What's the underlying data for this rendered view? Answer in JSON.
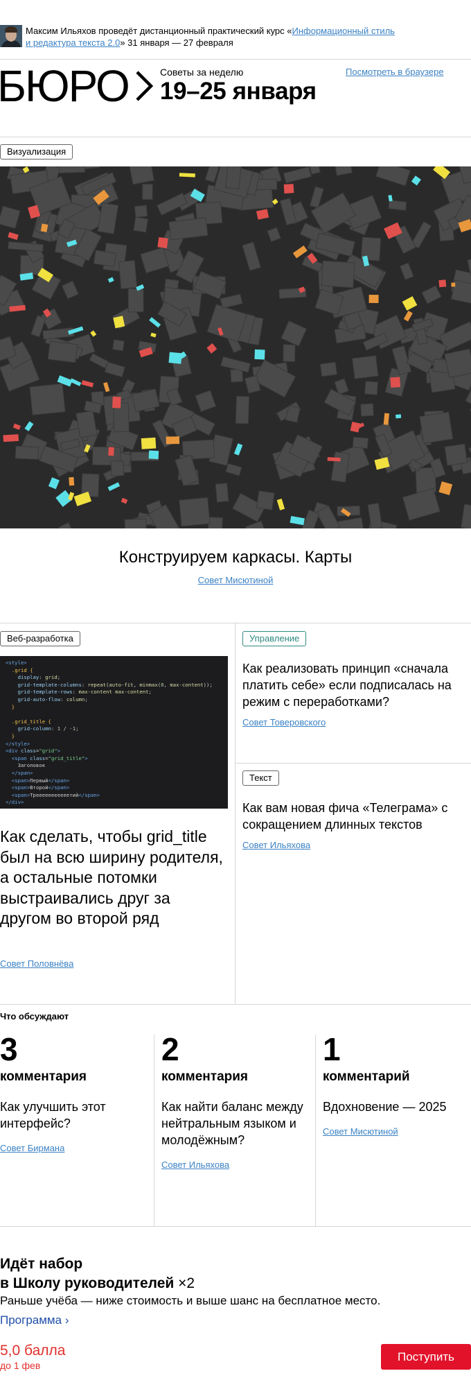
{
  "promo": {
    "text_before": "Максим Ильяхов проведёт дистанционный практический курс «",
    "course_line1": "Информационный стиль",
    "course_line2": "и редактура текста 2.0",
    "text_after": "» 31 января — 27 февраля"
  },
  "header": {
    "logo_text": "БЮРО",
    "kicker": "Советы за неделю",
    "date_range": "19–25 января",
    "browser_link": "Посмотреть в браузере"
  },
  "featured": {
    "tag": "Визуализация",
    "title": "Конструируем каркасы. Карты",
    "author": "Совет Мисютиной"
  },
  "grid_article": {
    "tag": "Веб-разработка",
    "title": "Как сделать, чтобы grid_title был на всю ширину родителя, а остальные потомки выстраивались друг за другом во второй ряд",
    "author": "Совет Половнёва"
  },
  "side_articles": [
    {
      "tag": "Управление",
      "title": "Как реализовать принцип «сначала платить себе» если подписалась на режим с переработками?",
      "author": "Совет Товеровского"
    },
    {
      "tag": "Текст",
      "title": "Как вам новая фича «Телеграма» с сокращением длинных текстов",
      "author": "Совет Ильяхова"
    }
  ],
  "discussed": {
    "heading": "Что обсуждают",
    "items": [
      {
        "count": "3",
        "word": "комментария",
        "title": "Как улучшить этот интерфейс?",
        "author": "Совет Бирмана"
      },
      {
        "count": "2",
        "word": "комментария",
        "title": "Как найти баланс между нейтральным языком и молодёжным?",
        "author": "Совет Ильяхова"
      },
      {
        "count": "1",
        "word": "комментарий",
        "title": "Вдохновение — 2025",
        "author": "Совет Мисютиной"
      }
    ]
  },
  "school": {
    "line1": "Идёт набор",
    "line2": "в Школу руководителей",
    "badge": "×2",
    "subtitle": "Раньше учёба — ниже стоимость и выше шанс на бесплатное место.",
    "program_link": "Программа",
    "score": "5,0 балла",
    "deadline": "до 1 фев",
    "apply_button": "Поступить"
  },
  "colors": {
    "link": "#3b82c4",
    "map_background": "#2a2a2a",
    "map_building": "#4a4a4a",
    "map_red": "#e0504d",
    "map_cyan": "#5be0e8",
    "map_yellow": "#f0e040",
    "map_orange": "#e8973d",
    "accent_red": "#e3122b",
    "tag_teal": "#2f8a80"
  }
}
